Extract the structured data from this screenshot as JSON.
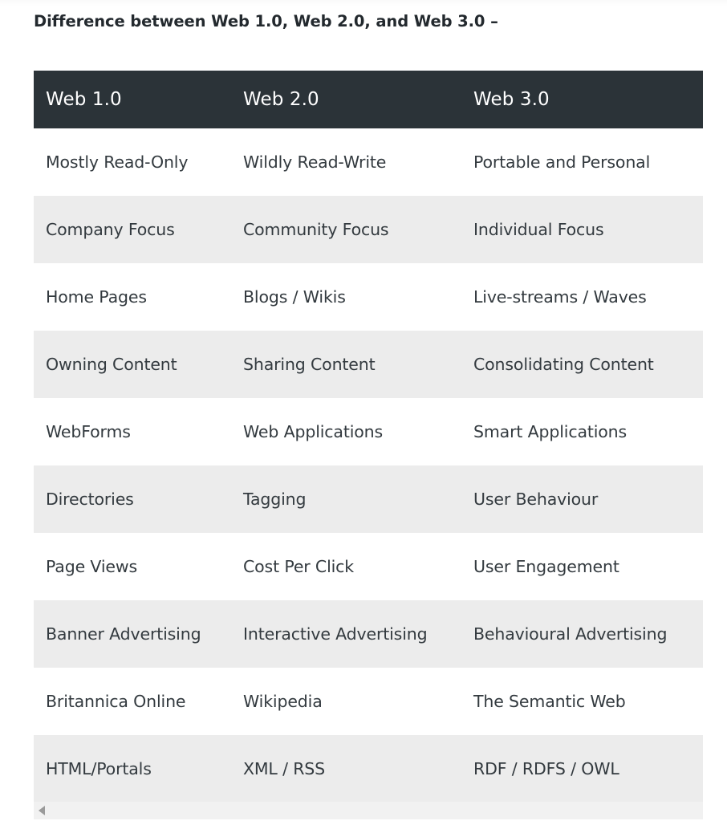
{
  "page": {
    "title": "Difference between Web 1.0, Web 2.0, and Web 3.0 –",
    "background_color": "#ffffff"
  },
  "colors": {
    "header_background": "#2b3338",
    "header_text": "#ffffff",
    "row_alt_background": "#ececec",
    "row_background": "#ffffff",
    "body_text": "#333a3f",
    "title_text": "#23292e",
    "scrollbar_track": "#f1f1f1",
    "scrollbar_arrow": "#9a9a9a"
  },
  "table": {
    "columns": [
      "Web 1.0",
      "Web 2.0",
      "Web 3.0"
    ],
    "rows": [
      [
        "Mostly Read-Only",
        "Wildly Read-Write",
        "Portable and Personal"
      ],
      [
        "Company Focus",
        "Community Focus",
        "Individual Focus"
      ],
      [
        "Home Pages",
        "Blogs / Wikis",
        "Live-streams / Waves"
      ],
      [
        "Owning Content",
        "Sharing Content",
        "Consolidating Content"
      ],
      [
        "WebForms",
        "Web Applications",
        "Smart Applications"
      ],
      [
        "Directories",
        "Tagging",
        "User Behaviour"
      ],
      [
        "Page Views",
        "Cost Per Click",
        "User Engagement"
      ],
      [
        "Banner Advertising",
        "Interactive Advertising",
        "Behavioural Advertising"
      ],
      [
        "Britannica Online",
        "Wikipedia",
        "The Semantic Web"
      ],
      [
        "HTML/Portals",
        "XML / RSS",
        "RDF / RDFS / OWL"
      ]
    ]
  },
  "scrollbar": {
    "orientation": "horizontal",
    "left_arrow_icon": "triangle-left-icon"
  }
}
